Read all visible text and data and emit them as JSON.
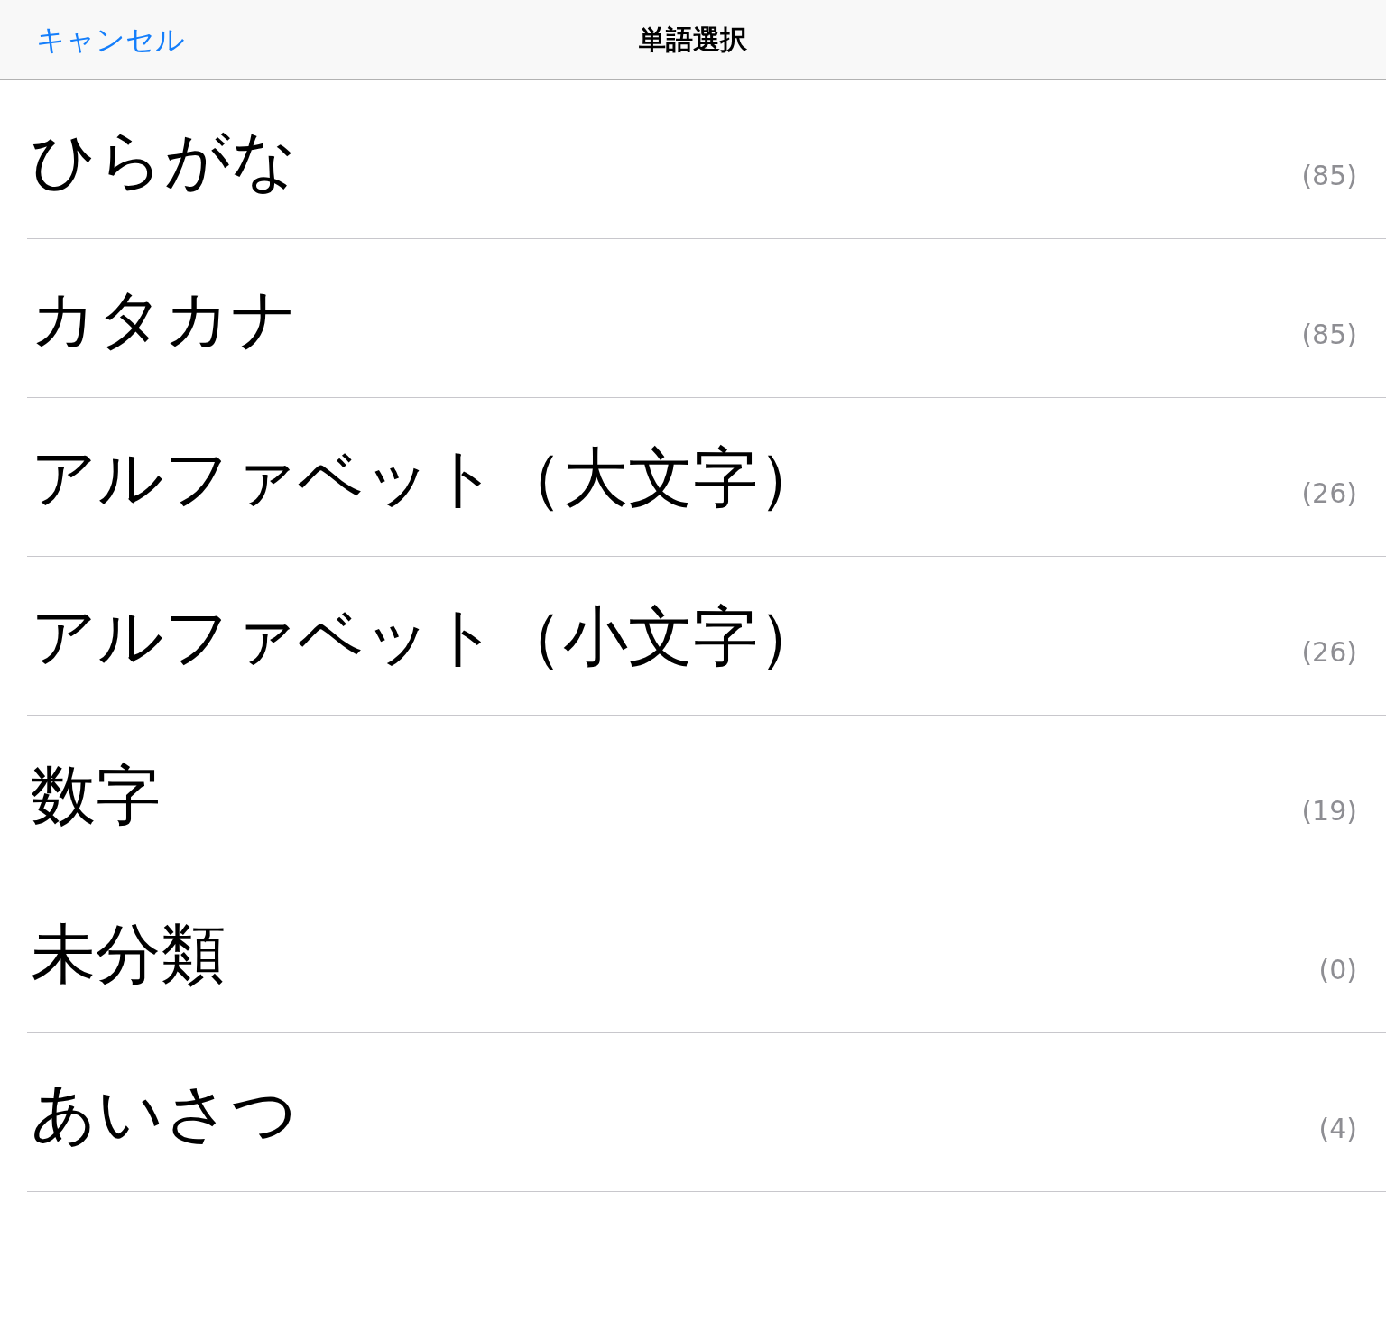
{
  "nav_bar": {
    "cancel_button": "キャンセル",
    "title": "単語選択"
  },
  "categories": [
    {
      "label": "ひらがな",
      "count": "(85)"
    },
    {
      "label": "カタカナ",
      "count": "(85)"
    },
    {
      "label": "アルファベット（大文字）",
      "count": "(26)"
    },
    {
      "label": "アルファベット（小文字）",
      "count": "(26)"
    },
    {
      "label": "数字",
      "count": "(19)"
    },
    {
      "label": "未分類",
      "count": "(0)"
    },
    {
      "label": "あいさつ",
      "count": "(4)"
    }
  ]
}
